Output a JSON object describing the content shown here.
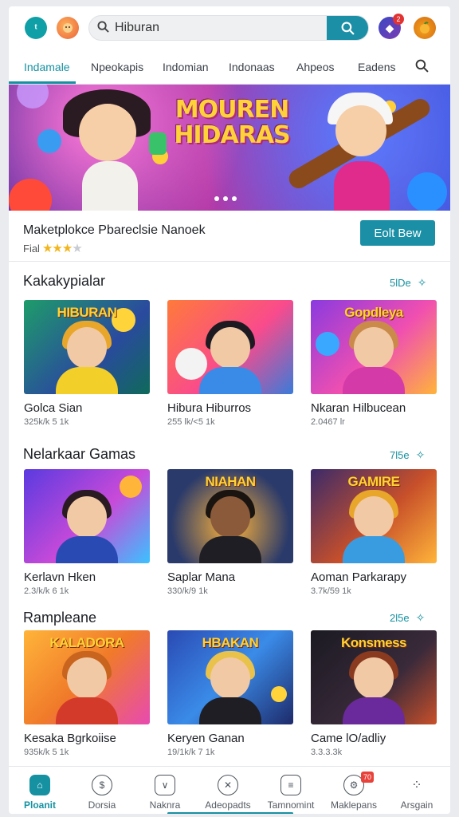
{
  "header": {
    "search_value": "Hiburan",
    "notification_count": "2"
  },
  "tabs": [
    {
      "label": "Indamale"
    },
    {
      "label": "Npeokapis"
    },
    {
      "label": "Indomian"
    },
    {
      "label": "Indonaas"
    },
    {
      "label": "Ahpeos"
    },
    {
      "label": "Eadens"
    }
  ],
  "banner": {
    "title": "MOUREN HIDARAS"
  },
  "featured": {
    "title": "Maketplokce Pbareclsie Nanoek",
    "rating_prefix": "Fial",
    "stars_filled": 3,
    "stars_total": 4,
    "button_label": "Eolt Bew"
  },
  "sections": [
    {
      "title": "Kakakypialar",
      "more": "5lDe",
      "cards": [
        {
          "title": "Golca Sian",
          "sub": "325k/k 5 1k",
          "thumb_text": "HIBURAN"
        },
        {
          "title": "Hibura Hiburros",
          "sub": "255 lk/<5 1k",
          "thumb_text": ""
        },
        {
          "title": "Nkaran Hilbucean",
          "sub": "2.0467 lr",
          "thumb_text": "Gopdleya"
        }
      ]
    },
    {
      "title": "Nelarkaar Gamas",
      "more": "7l5e",
      "cards": [
        {
          "title": "Kerlavn Hken",
          "sub": "2.3/k/k 6 1k",
          "thumb_text": ""
        },
        {
          "title": "Saplar Mana",
          "sub": "330/k/9 1k",
          "thumb_text": "NIAHAN"
        },
        {
          "title": "Aoman Parkarapy",
          "sub": "3.7k/59 1k",
          "thumb_text": "GAMIRE"
        }
      ]
    },
    {
      "title": "Rampleane",
      "more": "2l5e",
      "cards": [
        {
          "title": "Kesaka Bgrkoiise",
          "sub": "935k/k 5 1k",
          "thumb_text": "KALADORA"
        },
        {
          "title": "Keryen Ganan",
          "sub": "19/1k/k 7 1k",
          "thumb_text": "HBAKAN"
        },
        {
          "title": "Came lO/adliy",
          "sub": "3.3.3.3k",
          "thumb_text": "Konsmess"
        }
      ]
    }
  ],
  "bottom_nav": [
    {
      "label": "Ploanit"
    },
    {
      "label": "Dorsia"
    },
    {
      "label": "Naknra"
    },
    {
      "label": "Adeopadts"
    },
    {
      "label": "Tamnomint"
    },
    {
      "label": "Maklepans",
      "badge": "70"
    },
    {
      "label": "Arsgain"
    }
  ]
}
